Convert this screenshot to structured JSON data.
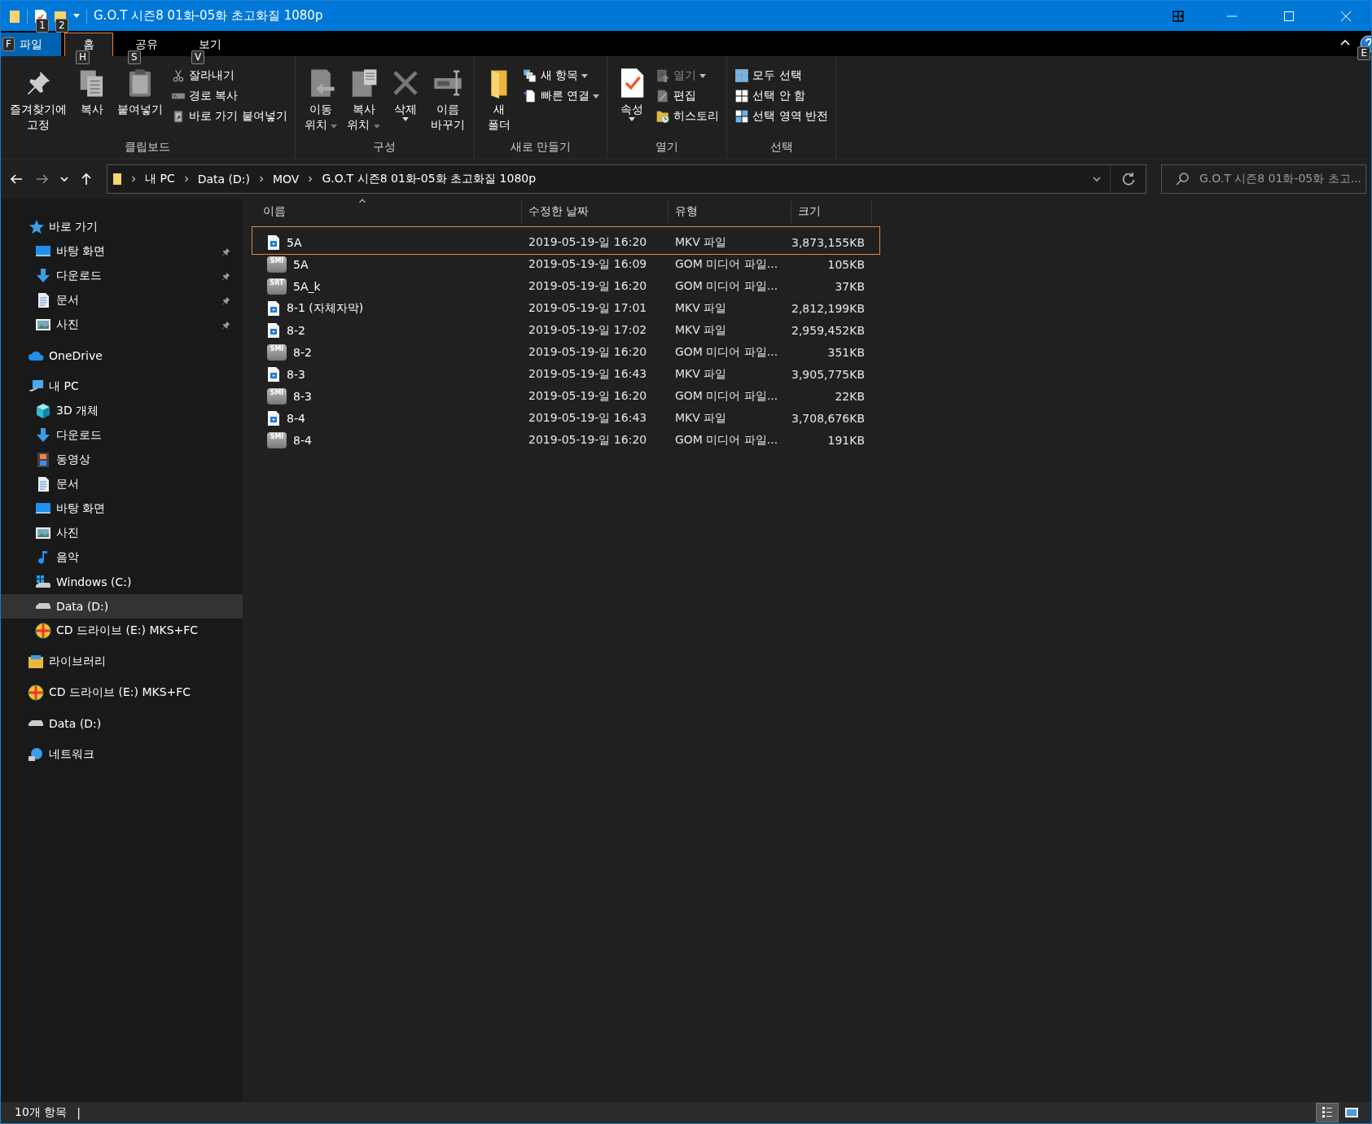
{
  "title_bar": {
    "title": "G.O.T 시즌8 01화-05화 초고화질 1080p",
    "quick_access_keytips": [
      "1",
      "2"
    ]
  },
  "ribbon_tabs": [
    {
      "label": "파일",
      "selected": false,
      "kind": "file",
      "keytip": "F"
    },
    {
      "label": "홈",
      "selected": true,
      "kind": "tab",
      "keytip": "H"
    },
    {
      "label": "공유",
      "selected": false,
      "kind": "tab",
      "keytip": "S"
    },
    {
      "label": "보기",
      "selected": false,
      "kind": "tab",
      "keytip": "V"
    }
  ],
  "help_keytip": "E",
  "ribbon_groups": [
    {
      "label": "클립보드",
      "items": [
        {
          "kind": "large",
          "lines": [
            "즐겨찾기에",
            "고정"
          ],
          "dropdown": false,
          "disabled": false
        },
        {
          "kind": "large",
          "lines": [
            "복사"
          ],
          "dropdown": false,
          "disabled": false
        },
        {
          "kind": "large",
          "lines": [
            "붙여넣기"
          ],
          "dropdown": false,
          "disabled": false
        },
        {
          "kind": "small",
          "lines": [
            "잘라내기"
          ],
          "dropdown": false,
          "disabled": false
        },
        {
          "kind": "small",
          "lines": [
            "경로 복사"
          ],
          "dropdown": false,
          "disabled": false
        },
        {
          "kind": "small",
          "lines": [
            "바로 가기 붙여넣기"
          ],
          "dropdown": false,
          "disabled": false
        }
      ]
    },
    {
      "label": "구성",
      "items": [
        {
          "kind": "large",
          "lines": [
            "이동",
            "위치"
          ],
          "dropdown": true,
          "disabled": false
        },
        {
          "kind": "large",
          "lines": [
            "복사",
            "위치"
          ],
          "dropdown": true,
          "disabled": false
        },
        {
          "kind": "large",
          "lines": [
            "삭제"
          ],
          "dropdown": true,
          "disabled": false
        },
        {
          "kind": "large",
          "lines": [
            "이름",
            "바꾸기"
          ],
          "dropdown": false,
          "disabled": false
        }
      ]
    },
    {
      "label": "새로 만들기",
      "items": [
        {
          "kind": "large",
          "lines": [
            "새",
            "폴더"
          ],
          "dropdown": false,
          "disabled": false
        },
        {
          "kind": "small",
          "lines": [
            "새 항목"
          ],
          "dropdown": true,
          "disabled": false
        },
        {
          "kind": "small",
          "lines": [
            "빠른 연결"
          ],
          "dropdown": true,
          "disabled": false
        }
      ]
    },
    {
      "label": "열기",
      "items": [
        {
          "kind": "large",
          "lines": [
            "속성"
          ],
          "dropdown": true,
          "disabled": false
        },
        {
          "kind": "small",
          "lines": [
            "열기"
          ],
          "dropdown": true,
          "disabled": true
        },
        {
          "kind": "small",
          "lines": [
            "편집"
          ],
          "dropdown": false,
          "disabled": false
        },
        {
          "kind": "small",
          "lines": [
            "히스토리"
          ],
          "dropdown": false,
          "disabled": false
        }
      ]
    },
    {
      "label": "선택",
      "items": [
        {
          "kind": "small",
          "lines": [
            "모두 선택"
          ],
          "dropdown": false,
          "disabled": false
        },
        {
          "kind": "small",
          "lines": [
            "선택 안 함"
          ],
          "dropdown": false,
          "disabled": false
        },
        {
          "kind": "small",
          "lines": [
            "선택 영역 반전"
          ],
          "dropdown": false,
          "disabled": false
        }
      ]
    }
  ],
  "address_bar": {
    "path": [
      "내 PC",
      "Data (D:)",
      "MOV",
      "G.O.T 시즌8 01화-05화 초고화질 1080p"
    ]
  },
  "search": {
    "placeholder": "G.O.T 시즌8 01화-05화 초고..."
  },
  "sidebar": [
    {
      "label": "바로 가기",
      "kind": "star",
      "selected": false,
      "children": [
        {
          "label": "바탕 화면",
          "kind": "desktop",
          "selected": false,
          "pinned": true
        },
        {
          "label": "다운로드",
          "kind": "download",
          "selected": false,
          "pinned": true
        },
        {
          "label": "문서",
          "kind": "document",
          "selected": false,
          "pinned": true
        },
        {
          "label": "사진",
          "kind": "picture",
          "selected": false,
          "pinned": true
        }
      ]
    },
    {
      "label": "OneDrive",
      "kind": "cloud",
      "selected": false
    },
    {
      "label": "내 PC",
      "kind": "pc",
      "selected": false,
      "children": [
        {
          "label": "3D 개체",
          "kind": "cube",
          "selected": false
        },
        {
          "label": "다운로드",
          "kind": "download",
          "selected": false
        },
        {
          "label": "동영상",
          "kind": "video",
          "selected": false
        },
        {
          "label": "문서",
          "kind": "document",
          "selected": false
        },
        {
          "label": "바탕 화면",
          "kind": "desktop",
          "selected": false
        },
        {
          "label": "사진",
          "kind": "picture",
          "selected": false
        },
        {
          "label": "음악",
          "kind": "music",
          "selected": false
        },
        {
          "label": "Windows (C:)",
          "kind": "windrive",
          "selected": false
        },
        {
          "label": "Data (D:)",
          "kind": "drive",
          "selected": true
        },
        {
          "label": "CD 드라이브 (E:) MKS+FC",
          "kind": "cd",
          "selected": false
        }
      ]
    },
    {
      "label": "라이브러리",
      "kind": "library",
      "selected": false
    },
    {
      "label": "CD 드라이브 (E:) MKS+FC",
      "kind": "cd",
      "selected": false
    },
    {
      "label": "Data (D:)",
      "kind": "drive",
      "selected": false
    },
    {
      "label": "네트워크",
      "kind": "network",
      "selected": false
    }
  ],
  "file_list": {
    "columns": [
      "이름",
      "수정한 날짜",
      "유형",
      "크기"
    ],
    "rows": [
      {
        "name": "5A",
        "modified": "2019-05-19-일 16:20",
        "type": "MKV 파일",
        "size": "3,873,155KB",
        "kind": "video",
        "focused": true
      },
      {
        "name": "5A",
        "modified": "2019-05-19-일 16:09",
        "type": "GOM 미디어 파일...",
        "size": "105KB",
        "kind": "subtitle",
        "badge": "SMI",
        "focused": false
      },
      {
        "name": "5A_k",
        "modified": "2019-05-19-일 16:20",
        "type": "GOM 미디어 파일...",
        "size": "37KB",
        "kind": "subtitle",
        "badge": "SRT",
        "focused": false
      },
      {
        "name": "8-1 (자체자막)",
        "modified": "2019-05-19-일 17:01",
        "type": "MKV 파일",
        "size": "2,812,199KB",
        "kind": "video",
        "focused": false
      },
      {
        "name": "8-2",
        "modified": "2019-05-19-일 17:02",
        "type": "MKV 파일",
        "size": "2,959,452KB",
        "kind": "video",
        "focused": false
      },
      {
        "name": "8-2",
        "modified": "2019-05-19-일 16:20",
        "type": "GOM 미디어 파일...",
        "size": "351KB",
        "kind": "subtitle",
        "badge": "SMI",
        "focused": false
      },
      {
        "name": "8-3",
        "modified": "2019-05-19-일 16:43",
        "type": "MKV 파일",
        "size": "3,905,775KB",
        "kind": "video",
        "focused": false
      },
      {
        "name": "8-3",
        "modified": "2019-05-19-일 16:20",
        "type": "GOM 미디어 파일...",
        "size": "22KB",
        "kind": "subtitle",
        "badge": "SMI",
        "focused": false
      },
      {
        "name": "8-4",
        "modified": "2019-05-19-일 16:43",
        "type": "MKV 파일",
        "size": "3,708,676KB",
        "kind": "video",
        "focused": false
      },
      {
        "name": "8-4",
        "modified": "2019-05-19-일 16:20",
        "type": "GOM 미디어 파일...",
        "size": "191KB",
        "kind": "subtitle",
        "badge": "SMI",
        "focused": false
      }
    ]
  },
  "status_bar": {
    "count": "10개 항목",
    "separator": "|",
    "views": [
      {
        "kind": "details",
        "selected": true
      },
      {
        "kind": "large-icons",
        "selected": false
      }
    ]
  }
}
